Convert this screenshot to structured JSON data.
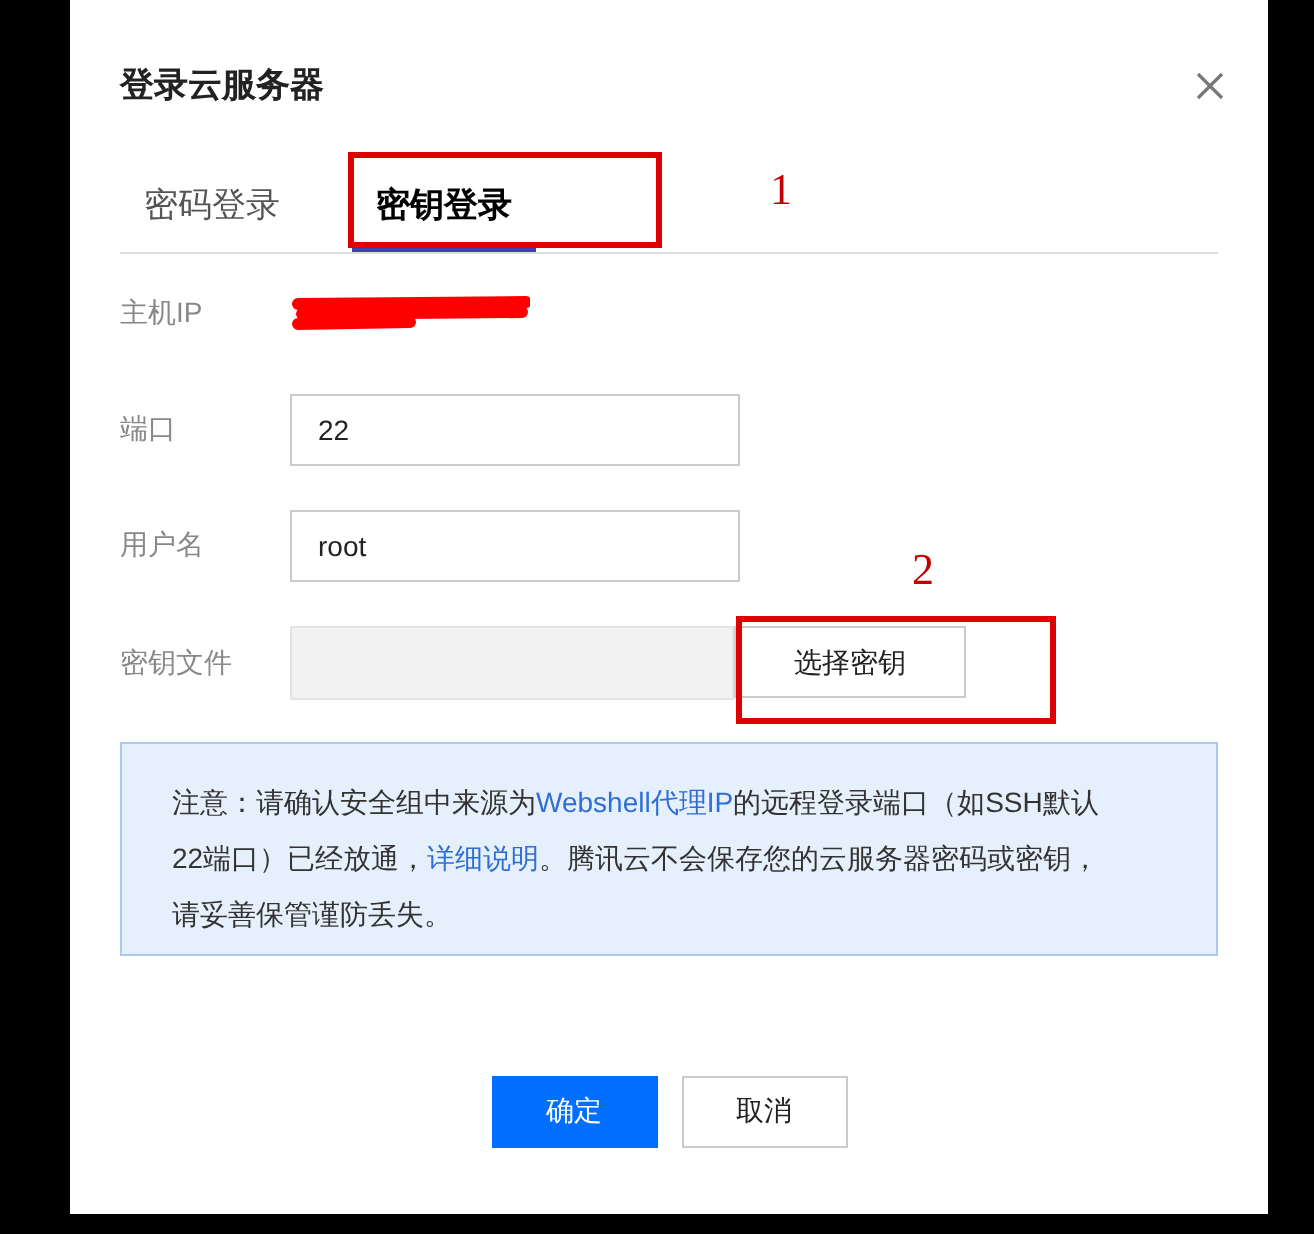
{
  "dialog": {
    "title": "登录云服务器"
  },
  "tabs": [
    {
      "label": "密码登录",
      "selected": false
    },
    {
      "label": "密钥登录",
      "selected": true
    }
  ],
  "form": {
    "host_label": "主机IP",
    "host_redacted": true,
    "fields": [
      {
        "label": "端口",
        "value": "22"
      },
      {
        "label": "用户名",
        "value": "root"
      }
    ],
    "key_file": {
      "label": "密钥文件",
      "button": "选择密钥"
    }
  },
  "notice": [
    {
      "kind": "text",
      "text": "注意：请确认安全组中来源为"
    },
    {
      "kind": "link",
      "text": "Webshell代理IP"
    },
    {
      "kind": "text",
      "text": "的远程登录端口（如SSH默认22端口）已经放通，"
    },
    {
      "kind": "link",
      "text": "详细说明"
    },
    {
      "kind": "text",
      "text": "。腾讯云不会保存您的云服务器密码或密钥，请妥善保管谨防丢失。"
    }
  ],
  "buttons": [
    {
      "label": "确定",
      "kind": "primary"
    },
    {
      "label": "取消",
      "kind": "secondary"
    }
  ],
  "annotations": [
    {
      "label": "1"
    },
    {
      "label": "2"
    }
  ]
}
